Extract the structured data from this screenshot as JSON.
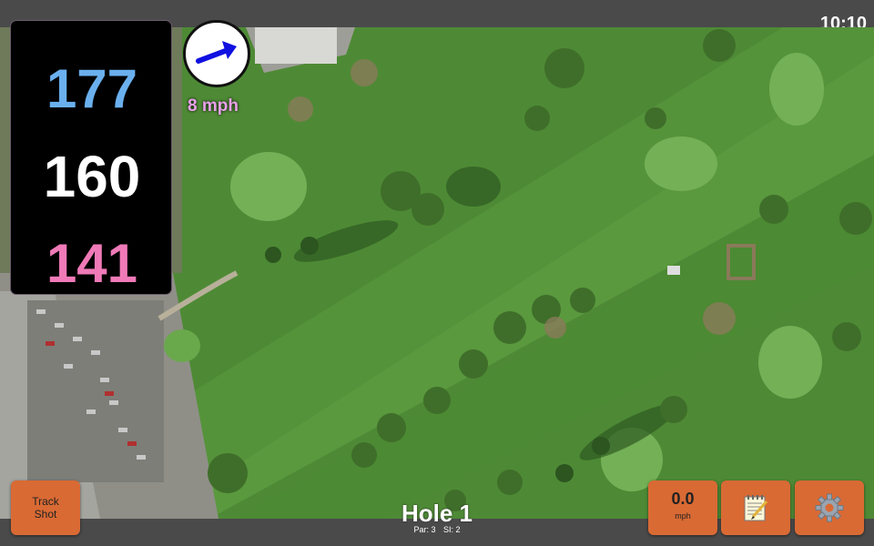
{
  "status": {
    "clock": "10:10"
  },
  "distances": {
    "back": "177",
    "middle": "160",
    "front": "141"
  },
  "wind": {
    "direction_icon": "arrow-right-up-icon",
    "speed": "8 mph"
  },
  "hole": {
    "title": "Hole 1",
    "par": "Par: 3",
    "si": "SI: 2"
  },
  "buttons": {
    "track_shot_line1": "Track",
    "track_shot_line2": "Shot",
    "wind_value": "0.0",
    "wind_unit": "mph",
    "notes_icon": "notepad-icon",
    "settings_icon": "gear-icon"
  },
  "colors": {
    "accent_orange": "#d96a34",
    "back_yardage": "#6ab0ee",
    "middle_yardage": "#ffffff",
    "front_yardage": "#f07ab8",
    "wind_text": "#e8a0e8",
    "map_fairway": "#5a9a3e"
  }
}
